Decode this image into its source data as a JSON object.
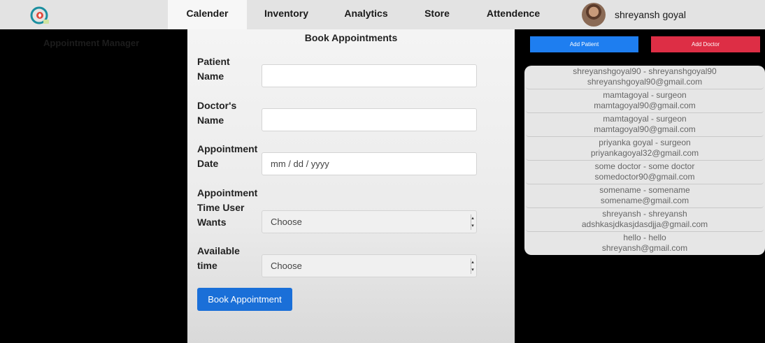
{
  "nav": {
    "tabs": [
      {
        "label": "Calender",
        "active": true
      },
      {
        "label": "Inventory",
        "active": false
      },
      {
        "label": "Analytics",
        "active": false
      },
      {
        "label": "Store",
        "active": false
      },
      {
        "label": "Attendence",
        "active": false
      }
    ]
  },
  "user": {
    "name": "shreyansh goyal"
  },
  "left": {
    "title": "Appointment Manager"
  },
  "form": {
    "title": "Book Appointments",
    "patient_label": "Patient\nName",
    "doctor_label": "Doctor's\nName",
    "date_label": "Appointment\nDate",
    "date_placeholder": "mm / dd / yyyy",
    "time_label": "Appointment\nTime User\nWants",
    "time_value": "Choose",
    "avail_label": "Available\ntime",
    "avail_value": "Choose",
    "submit_label": "Book Appointment"
  },
  "actions": {
    "add_patient": "Add Patient",
    "add_doctor": "Add Doctor"
  },
  "doctors": [
    {
      "line1": "shreyanshgoyal90   -   shreyanshgoyal90",
      "line2": "shreyanshgoyal90@gmail.com"
    },
    {
      "line1": "mamtagoyal   -   surgeon",
      "line2": "mamtagoyal90@gmail.com"
    },
    {
      "line1": "mamtagoyal   -   surgeon",
      "line2": "mamtagoyal90@gmail.com"
    },
    {
      "line1": "priyanka goyal   -   surgeon",
      "line2": "priyankagoyal32@gmail.com"
    },
    {
      "line1": "some doctor   -   some doctor",
      "line2": "somedoctor90@gmail.com"
    },
    {
      "line1": "somename   -   somename",
      "line2": "somename@gmail.com"
    },
    {
      "line1": "shreyansh   -   shreyansh",
      "line2": "adshkasjdkasjdasdjja@gmail.com"
    },
    {
      "line1": "hello   -   hello",
      "line2": "shreyansh@gmail.com"
    }
  ],
  "colors": {
    "primary": "#1a6fd8",
    "danger": "#dd2e45",
    "nav_bg": "#e3e3e3"
  }
}
